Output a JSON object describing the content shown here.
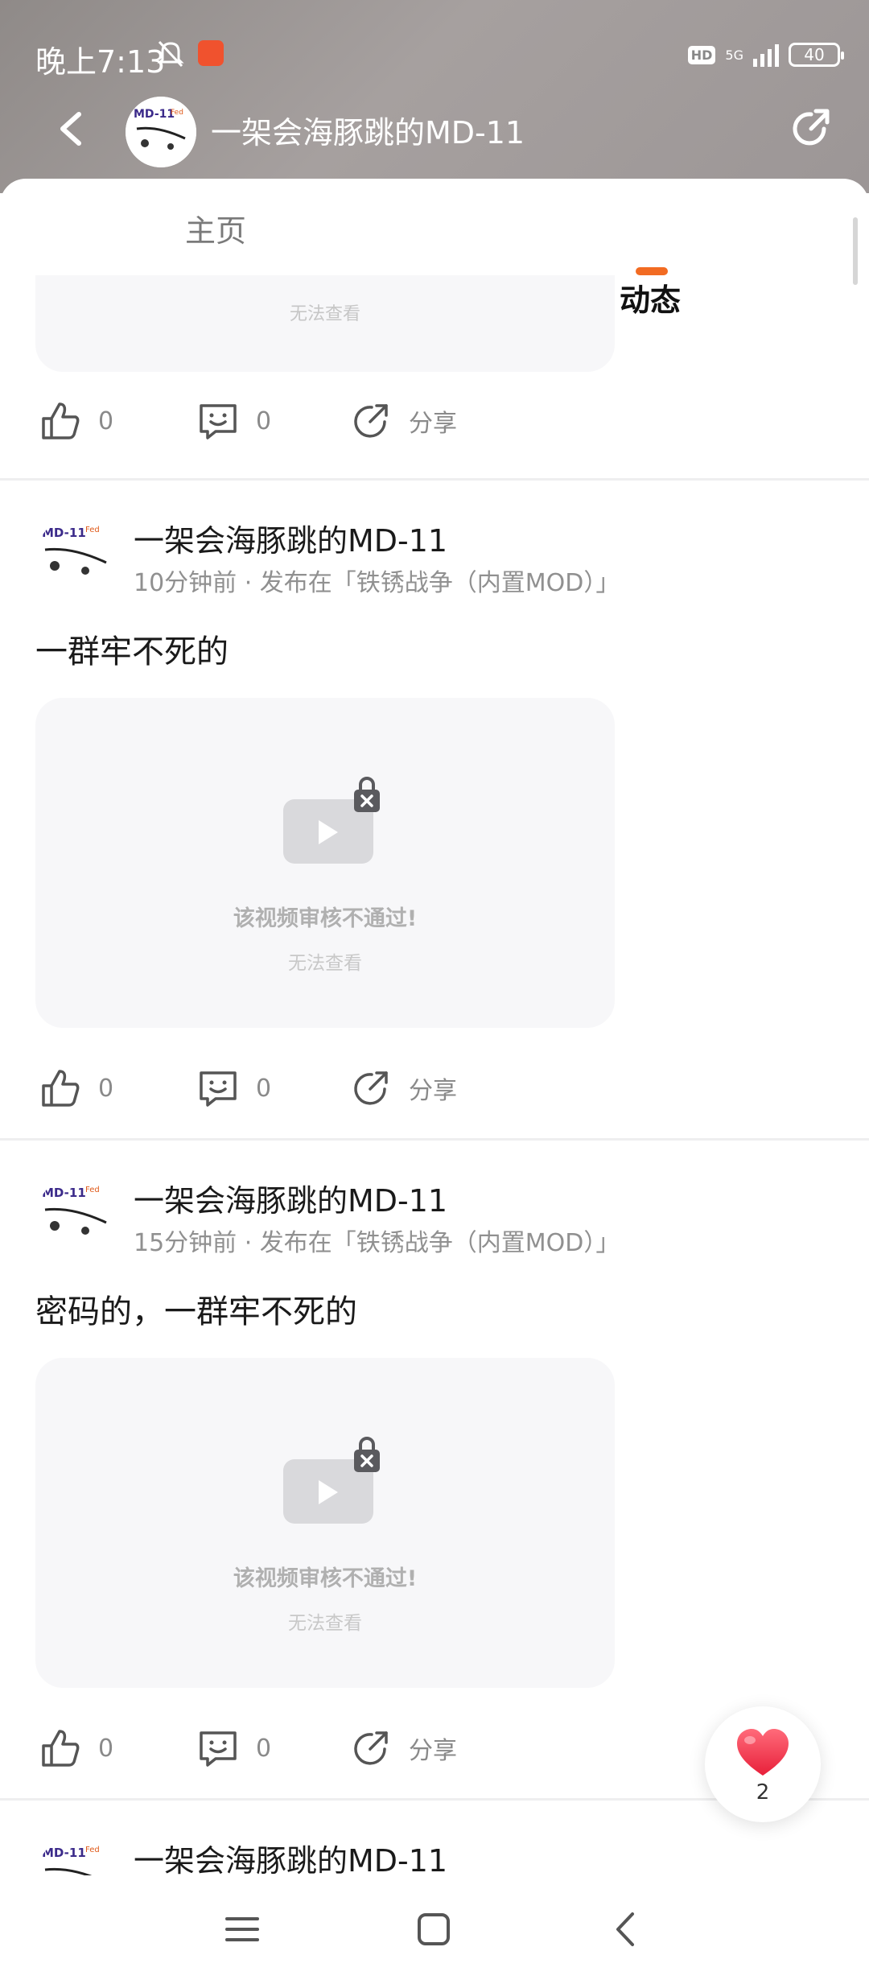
{
  "status_bar": {
    "time": "晚上7:13",
    "hd": "HD",
    "network": "5G",
    "battery": "40"
  },
  "header": {
    "title": "一架会海豚跳的MD-11",
    "avatar_text": "MD-11"
  },
  "tabs": [
    {
      "label": "主页"
    },
    {
      "label": "动态"
    }
  ],
  "partial_post": {
    "video_sub": "无法查看",
    "likes": "0",
    "comments": "0",
    "share": "分享"
  },
  "posts": [
    {
      "author": "一架会海豚跳的MD-11",
      "meta": "10分钟前 · 发布在「铁锈战争（内置MOD）」",
      "text": "一群牢不死的",
      "video_title": "该视频审核不通过!",
      "video_sub": "无法查看",
      "likes": "0",
      "comments": "0",
      "share": "分享"
    },
    {
      "author": "一架会海豚跳的MD-11",
      "meta": "15分钟前 · 发布在「铁锈战争（内置MOD）」",
      "text": "密码的，一群牢不死的",
      "video_title": "该视频审核不通过!",
      "video_sub": "无法查看",
      "likes": "0",
      "comments": "0",
      "share": "分享"
    },
    {
      "author": "一架会海豚跳的MD-11"
    }
  ],
  "floating": {
    "likes": "2"
  },
  "colors": {
    "accent": "#f26b22",
    "heart": "#f0354c"
  }
}
